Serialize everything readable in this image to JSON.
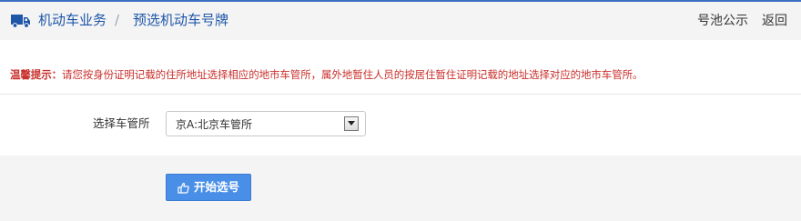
{
  "header": {
    "breadcrumb": [
      "机动车业务",
      "预选机动车号牌"
    ],
    "separator": "/",
    "links": {
      "pool": "号池公示",
      "back": "返回"
    }
  },
  "tip": {
    "label": "温馨提示：",
    "text": "请您按身份证明记载的住所地址选择相应的地市车管所，属外地暂住人员的按居住暂住证明记载的地址选择对应的地市车管所。"
  },
  "form": {
    "office_label": "选择车管所",
    "office_value": "京A:北京车管所"
  },
  "actions": {
    "start_label": "开始选号"
  },
  "colors": {
    "accent": "#1e56a8",
    "tip": "#c9302c",
    "button": "#4a8fe7",
    "panel": "#f4f4f4"
  },
  "icons": [
    "truck-icon",
    "chevron-down-icon",
    "hand-point-icon"
  ]
}
